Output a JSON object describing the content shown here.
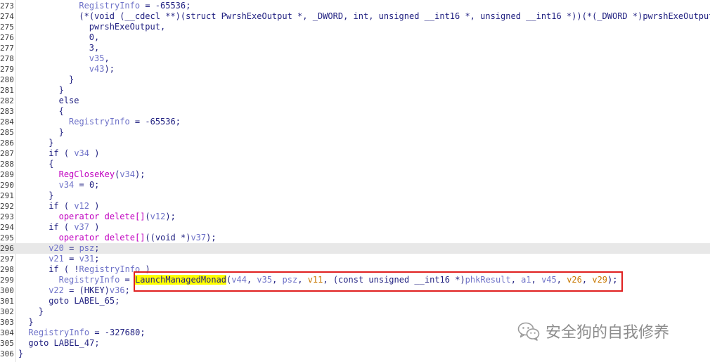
{
  "lines": [
    {
      "num": "273",
      "indent": 12,
      "current": false,
      "tokens": [
        {
          "c": "t-var",
          "t": "RegistryInfo"
        },
        {
          "c": "t-plain",
          "t": " = -65536;"
        }
      ]
    },
    {
      "num": "274",
      "indent": 12,
      "current": false,
      "tokens": [
        {
          "c": "t-plain",
          "t": "(*(void (__cdecl **)(struct PwrshExeOutput *, _DWORD, int, unsigned __int16 *, unsigned __int16 *))(*(_DWORD *)pwrshExeOutput +"
        }
      ]
    },
    {
      "num": "275",
      "indent": 14,
      "current": false,
      "tokens": [
        {
          "c": "t-plain",
          "t": "pwrshExeOutput,"
        }
      ]
    },
    {
      "num": "276",
      "indent": 14,
      "current": false,
      "tokens": [
        {
          "c": "t-plain",
          "t": "0,"
        }
      ]
    },
    {
      "num": "277",
      "indent": 14,
      "current": false,
      "tokens": [
        {
          "c": "t-plain",
          "t": "3,"
        }
      ]
    },
    {
      "num": "278",
      "indent": 14,
      "current": false,
      "tokens": [
        {
          "c": "t-var",
          "t": "v35"
        },
        {
          "c": "t-plain",
          "t": ","
        }
      ]
    },
    {
      "num": "279",
      "indent": 14,
      "current": false,
      "tokens": [
        {
          "c": "t-var",
          "t": "v43"
        },
        {
          "c": "t-plain",
          "t": ");"
        }
      ]
    },
    {
      "num": "280",
      "indent": 10,
      "current": false,
      "tokens": [
        {
          "c": "t-plain",
          "t": "}"
        }
      ]
    },
    {
      "num": "281",
      "indent": 8,
      "current": false,
      "tokens": [
        {
          "c": "t-plain",
          "t": "}"
        }
      ]
    },
    {
      "num": "282",
      "indent": 8,
      "current": false,
      "tokens": [
        {
          "c": "t-kw",
          "t": "else"
        }
      ]
    },
    {
      "num": "283",
      "indent": 8,
      "current": false,
      "tokens": [
        {
          "c": "t-plain",
          "t": "{"
        }
      ]
    },
    {
      "num": "284",
      "indent": 10,
      "current": false,
      "tokens": [
        {
          "c": "t-var",
          "t": "RegistryInfo"
        },
        {
          "c": "t-plain",
          "t": " = -65536;"
        }
      ]
    },
    {
      "num": "285",
      "indent": 8,
      "current": false,
      "tokens": [
        {
          "c": "t-plain",
          "t": "}"
        }
      ]
    },
    {
      "num": "286",
      "indent": 6,
      "current": false,
      "tokens": [
        {
          "c": "t-plain",
          "t": "}"
        }
      ]
    },
    {
      "num": "287",
      "indent": 6,
      "current": false,
      "tokens": [
        {
          "c": "t-kw",
          "t": "if"
        },
        {
          "c": "t-plain",
          "t": " ( "
        },
        {
          "c": "t-var",
          "t": "v34"
        },
        {
          "c": "t-plain",
          "t": " )"
        }
      ]
    },
    {
      "num": "288",
      "indent": 6,
      "current": false,
      "tokens": [
        {
          "c": "t-plain",
          "t": "{"
        }
      ]
    },
    {
      "num": "289",
      "indent": 8,
      "current": false,
      "tokens": [
        {
          "c": "t-fn",
          "t": "RegCloseKey"
        },
        {
          "c": "t-plain",
          "t": "("
        },
        {
          "c": "t-var",
          "t": "v34"
        },
        {
          "c": "t-plain",
          "t": ");"
        }
      ]
    },
    {
      "num": "290",
      "indent": 8,
      "current": false,
      "tokens": [
        {
          "c": "t-var",
          "t": "v34"
        },
        {
          "c": "t-plain",
          "t": " = 0;"
        }
      ]
    },
    {
      "num": "291",
      "indent": 6,
      "current": false,
      "tokens": [
        {
          "c": "t-plain",
          "t": "}"
        }
      ]
    },
    {
      "num": "292",
      "indent": 6,
      "current": false,
      "tokens": [
        {
          "c": "t-kw",
          "t": "if"
        },
        {
          "c": "t-plain",
          "t": " ( "
        },
        {
          "c": "t-var",
          "t": "v12"
        },
        {
          "c": "t-plain",
          "t": " )"
        }
      ]
    },
    {
      "num": "293",
      "indent": 8,
      "current": false,
      "tokens": [
        {
          "c": "t-fn",
          "t": "operator delete[]"
        },
        {
          "c": "t-plain",
          "t": "("
        },
        {
          "c": "t-var",
          "t": "v12"
        },
        {
          "c": "t-plain",
          "t": ");"
        }
      ]
    },
    {
      "num": "294",
      "indent": 6,
      "current": false,
      "tokens": [
        {
          "c": "t-kw",
          "t": "if"
        },
        {
          "c": "t-plain",
          "t": " ( "
        },
        {
          "c": "t-var",
          "t": "v37"
        },
        {
          "c": "t-plain",
          "t": " )"
        }
      ]
    },
    {
      "num": "295",
      "indent": 8,
      "current": false,
      "tokens": [
        {
          "c": "t-fn",
          "t": "operator delete[]"
        },
        {
          "c": "t-plain",
          "t": "((void *)"
        },
        {
          "c": "t-var",
          "t": "v37"
        },
        {
          "c": "t-plain",
          "t": ");"
        }
      ]
    },
    {
      "num": "296",
      "indent": 6,
      "current": true,
      "tokens": [
        {
          "c": "t-var",
          "t": "v20"
        },
        {
          "c": "t-plain",
          "t": " = "
        },
        {
          "c": "t-var",
          "t": "psz"
        },
        {
          "c": "t-plain",
          "t": ";"
        }
      ]
    },
    {
      "num": "297",
      "indent": 6,
      "current": false,
      "tokens": [
        {
          "c": "t-var",
          "t": "v21"
        },
        {
          "c": "t-plain",
          "t": " = "
        },
        {
          "c": "t-var",
          "t": "v31"
        },
        {
          "c": "t-plain",
          "t": ";"
        }
      ]
    },
    {
      "num": "298",
      "indent": 6,
      "current": false,
      "tokens": [
        {
          "c": "t-kw",
          "t": "if"
        },
        {
          "c": "t-plain",
          "t": " ( !"
        },
        {
          "c": "t-var",
          "t": "RegistryInfo"
        },
        {
          "c": "t-plain",
          "t": " )"
        }
      ]
    },
    {
      "num": "299",
      "indent": 8,
      "current": false,
      "tokens": [
        {
          "c": "t-var",
          "t": "RegistryInfo"
        },
        {
          "c": "t-plain",
          "t": " = "
        },
        {
          "c": "t-hl",
          "t": "LaunchManagedMonad"
        },
        {
          "c": "t-plain",
          "t": "("
        },
        {
          "c": "t-var",
          "t": "v44"
        },
        {
          "c": "t-plain",
          "t": ", "
        },
        {
          "c": "t-var",
          "t": "v35"
        },
        {
          "c": "t-plain",
          "t": ", "
        },
        {
          "c": "t-var",
          "t": "psz"
        },
        {
          "c": "t-plain",
          "t": ", "
        },
        {
          "c": "t-arg",
          "t": "v11"
        },
        {
          "c": "t-plain",
          "t": ", (const unsigned __int16 *)"
        },
        {
          "c": "t-var",
          "t": "phkResult"
        },
        {
          "c": "t-plain",
          "t": ", "
        },
        {
          "c": "t-var",
          "t": "a1"
        },
        {
          "c": "t-plain",
          "t": ", "
        },
        {
          "c": "t-var",
          "t": "v45"
        },
        {
          "c": "t-plain",
          "t": ", "
        },
        {
          "c": "t-arg",
          "t": "v26"
        },
        {
          "c": "t-plain",
          "t": ", "
        },
        {
          "c": "t-arg",
          "t": "v29"
        },
        {
          "c": "t-plain",
          "t": ");"
        }
      ]
    },
    {
      "num": "300",
      "indent": 6,
      "current": false,
      "tokens": [
        {
          "c": "t-var",
          "t": "v22"
        },
        {
          "c": "t-plain",
          "t": " = (HKEY)"
        },
        {
          "c": "t-var",
          "t": "v36"
        },
        {
          "c": "t-plain",
          "t": ";"
        }
      ]
    },
    {
      "num": "301",
      "indent": 6,
      "current": false,
      "tokens": [
        {
          "c": "t-kw",
          "t": "goto"
        },
        {
          "c": "t-plain",
          "t": " LABEL_65;"
        }
      ]
    },
    {
      "num": "302",
      "indent": 4,
      "current": false,
      "tokens": [
        {
          "c": "t-plain",
          "t": "}"
        }
      ]
    },
    {
      "num": "303",
      "indent": 2,
      "current": false,
      "tokens": [
        {
          "c": "t-plain",
          "t": "}"
        }
      ]
    },
    {
      "num": "304",
      "indent": 2,
      "current": false,
      "tokens": [
        {
          "c": "t-var",
          "t": "RegistryInfo"
        },
        {
          "c": "t-plain",
          "t": " = -327680;"
        }
      ]
    },
    {
      "num": "305",
      "indent": 2,
      "current": false,
      "tokens": [
        {
          "c": "t-kw",
          "t": "goto"
        },
        {
          "c": "t-plain",
          "t": " LABEL_47;"
        }
      ]
    },
    {
      "num": "306",
      "indent": 0,
      "current": false,
      "tokens": [
        {
          "c": "t-plain",
          "t": "}"
        }
      ]
    }
  ],
  "watermark": {
    "text": "安全狗的自我修养",
    "icon": "wechat-icon"
  },
  "colors": {
    "highlight_box": "#e02020",
    "symbol_highlight": "#ffff00",
    "current_line": "#e8e8e8"
  }
}
